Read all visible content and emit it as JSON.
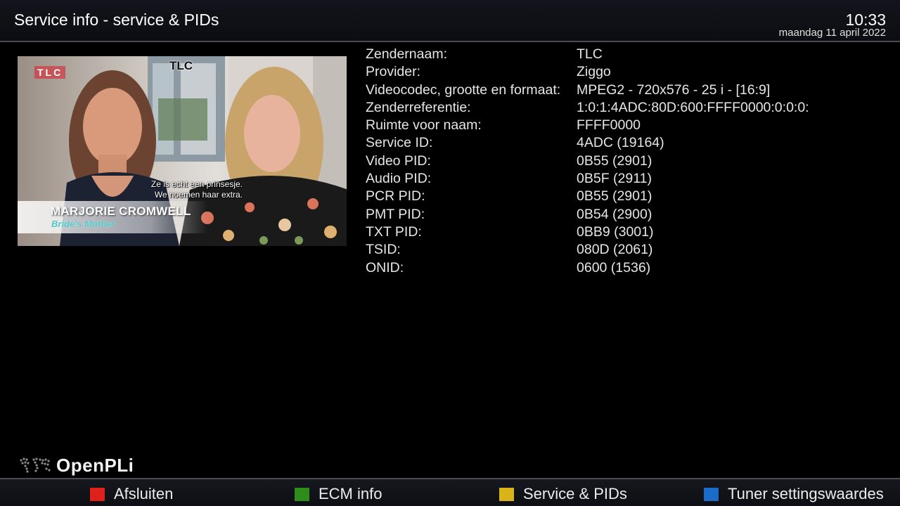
{
  "header": {
    "title": "Service info - service & PIDs",
    "time": "10:33",
    "date": "maandag 11 april 2022"
  },
  "preview": {
    "watermark": "TLC",
    "channel_tag": "TLC",
    "subtitle_line1": "Ze is echt een prinsesje.",
    "subtitle_line2": "We noemen haar extra.",
    "person_name": "MARJORIE CROMWELL",
    "person_role": "Bride's Mother"
  },
  "info": {
    "rows": [
      {
        "label": "Zendernaam:",
        "value": "TLC"
      },
      {
        "label": "Provider:",
        "value": "Ziggo"
      },
      {
        "label": "Videocodec, grootte en formaat:",
        "value": "MPEG2 - 720x576 - 25 i - [16:9]"
      },
      {
        "label": "Zenderreferentie:",
        "value": "1:0:1:4ADC:80D:600:FFFF0000:0:0:0:"
      },
      {
        "label": "Ruimte voor naam:",
        "value": "FFFF0000"
      },
      {
        "label": "Service ID:",
        "value": "4ADC (19164)"
      },
      {
        "label": "Video PID:",
        "value": "0B55 (2901)"
      },
      {
        "label": "Audio PID:",
        "value": "0B5F (2911)"
      },
      {
        "label": "PCR PID:",
        "value": "0B55 (2901)"
      },
      {
        "label": "PMT PID:",
        "value": "0B54 (2900)"
      },
      {
        "label": "TXT PID:",
        "value": "0BB9 (3001)"
      },
      {
        "label": "TSID:",
        "value": "080D (2061)"
      },
      {
        "label": "ONID:",
        "value": "0600 (1536)"
      }
    ]
  },
  "logo": {
    "text": "OpenPLi",
    "icon": "world-map-icon"
  },
  "footer": {
    "keys": [
      {
        "label": "Afsluiten",
        "color": "#e0201b",
        "icon": "red-key-icon"
      },
      {
        "label": "ECM info",
        "color": "#2e8c18",
        "icon": "green-key-icon"
      },
      {
        "label": "Service & PIDs",
        "color": "#d8b418",
        "icon": "yellow-key-icon"
      },
      {
        "label": "Tuner settingswaardes",
        "color": "#1a6cc8",
        "icon": "blue-key-icon"
      }
    ]
  }
}
